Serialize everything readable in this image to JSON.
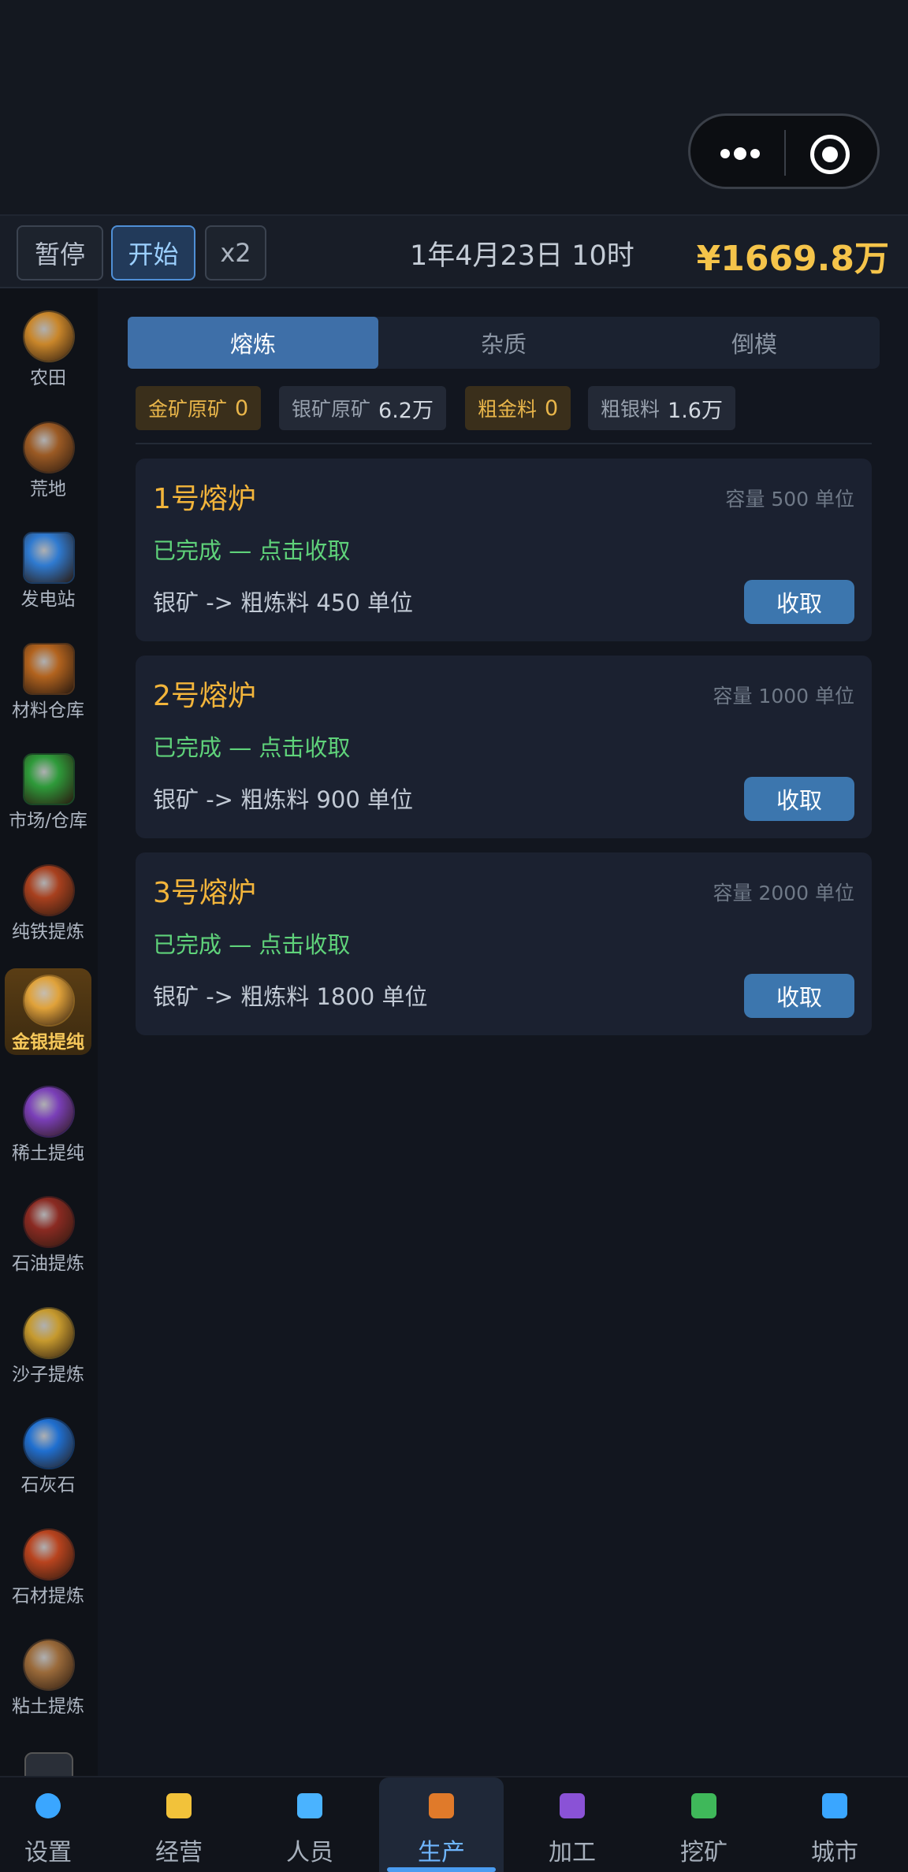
{
  "toolbar": {
    "pause_label": "暂停",
    "start_label": "开始",
    "speed_label": "x2",
    "date": "1年4月23日 10时",
    "money": "¥1669.8万"
  },
  "sidebar": {
    "items": [
      {
        "label": "农田",
        "icon": "farm-icon",
        "color": "#c9862a"
      },
      {
        "label": "荒地",
        "icon": "wasteland-icon",
        "color": "#9b5a24"
      },
      {
        "label": "发电站",
        "icon": "power-station-icon",
        "color": "#2f7ad0"
      },
      {
        "label": "材料仓库",
        "icon": "material-warehouse-icon",
        "color": "#b2631e"
      },
      {
        "label": "市场/仓库",
        "icon": "market-icon",
        "color": "#2e9a3a"
      },
      {
        "label": "纯铁提炼",
        "icon": "iron-refining-icon",
        "color": "#a8401e"
      },
      {
        "label": "金银提纯",
        "icon": "gold-silver-refining-icon",
        "color": "#e0a23a"
      },
      {
        "label": "稀土提纯",
        "icon": "rare-earth-icon",
        "color": "#7a3fb8"
      },
      {
        "label": "石油提炼",
        "icon": "oil-refining-icon",
        "color": "#8a2a22"
      },
      {
        "label": "沙子提炼",
        "icon": "sand-refining-icon",
        "color": "#c69a2e"
      },
      {
        "label": "石灰石",
        "icon": "limestone-icon",
        "color": "#1f6fd0"
      },
      {
        "label": "石材提炼",
        "icon": "stone-refining-icon",
        "color": "#b8431e"
      },
      {
        "label": "粘土提炼",
        "icon": "clay-refining-icon",
        "color": "#9a6a3a"
      }
    ],
    "active_index": 6
  },
  "tabs": [
    {
      "label": "熔炼",
      "active": true
    },
    {
      "label": "杂质",
      "active": false
    },
    {
      "label": "倒模",
      "active": false
    }
  ],
  "resources": [
    {
      "label": "金矿原矿",
      "value": "0",
      "highlight": true
    },
    {
      "label": "银矿原矿",
      "value": "6.2万",
      "highlight": false
    },
    {
      "label": "粗金料",
      "value": "0",
      "highlight": true
    },
    {
      "label": "粗银料",
      "value": "1.6万",
      "highlight": false
    }
  ],
  "furnaces": [
    {
      "title": "1号熔炉",
      "capacity": "容量 500 单位",
      "status": "已完成 — 点击收取",
      "desc": "银矿 -> 粗炼料 450 单位",
      "button": "收取"
    },
    {
      "title": "2号熔炉",
      "capacity": "容量 1000 单位",
      "status": "已完成 — 点击收取",
      "desc": "银矿 -> 粗炼料 900 单位",
      "button": "收取"
    },
    {
      "title": "3号熔炉",
      "capacity": "容量 2000 单位",
      "status": "已完成 — 点击收取",
      "desc": "银矿 -> 粗炼料 1800 单位",
      "button": "收取"
    }
  ],
  "bottom_nav": [
    {
      "label": "设置",
      "icon": "gear-icon",
      "active": false
    },
    {
      "label": "经营",
      "icon": "coins-icon",
      "active": false
    },
    {
      "label": "人员",
      "icon": "people-icon",
      "active": false
    },
    {
      "label": "生产",
      "icon": "factory-icon",
      "active": true
    },
    {
      "label": "加工",
      "icon": "processing-icon",
      "active": false
    },
    {
      "label": "挖矿",
      "icon": "mining-icon",
      "active": false
    },
    {
      "label": "城市",
      "icon": "city-icon",
      "active": false
    }
  ]
}
